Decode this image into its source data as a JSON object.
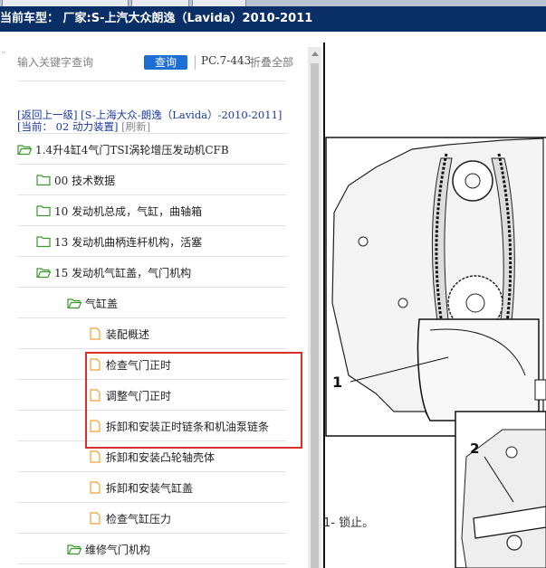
{
  "window": {
    "title": "当前车型： 厂家:S-上汽大众朗逸（Lavida）2010-2011"
  },
  "search": {
    "placeholder": "输入关键字查询",
    "button_label": "查询",
    "page_code": "PC.7-443",
    "collapse_label": "折叠全部"
  },
  "nav": {
    "back_link": "[返回上一级]",
    "model_link": "[S-上海大众-朗逸（Lavida）-2010-2011]",
    "current_prefix": "[当前：",
    "current_value": "02 动力装置]",
    "refresh_label": "[刷新]"
  },
  "tree": {
    "items": [
      {
        "label": "1.4升4缸4气门TSI涡轮增压发动机CFB",
        "type": "folder-open"
      },
      {
        "label": "00 技术数据",
        "type": "folder"
      },
      {
        "label": "10 发动机总成，气缸，曲轴箱",
        "type": "folder"
      },
      {
        "label": "13 发动机曲柄连杆机构，活塞",
        "type": "folder"
      },
      {
        "label": "15 发动机气缸盖，气门机构",
        "type": "folder-open"
      },
      {
        "label": "气缸盖",
        "type": "folder-open"
      },
      {
        "label": "装配概述",
        "type": "document"
      },
      {
        "label": "检查气门正时",
        "type": "document"
      },
      {
        "label": "调整气门正时",
        "type": "document"
      },
      {
        "label": "拆卸和安装正时链条和机油泵链条",
        "type": "document"
      },
      {
        "label": "拆卸和安装凸轮轴壳体",
        "type": "document"
      },
      {
        "label": "拆卸和安装气缸盖",
        "type": "document"
      },
      {
        "label": "检查气缸压力",
        "type": "document"
      },
      {
        "label": "维修气门机构",
        "type": "folder-open"
      }
    ]
  },
  "diagram": {
    "callouts": [
      "1",
      "2"
    ],
    "caption_fragment": "1- 锁止。"
  },
  "colors": {
    "titlebar": "#0a2f66",
    "search_button": "#1e6fd3",
    "link": "#1a3a9c",
    "highlight": "#d9302b",
    "folder": "#3a9a2a",
    "document": "#f0a030"
  }
}
